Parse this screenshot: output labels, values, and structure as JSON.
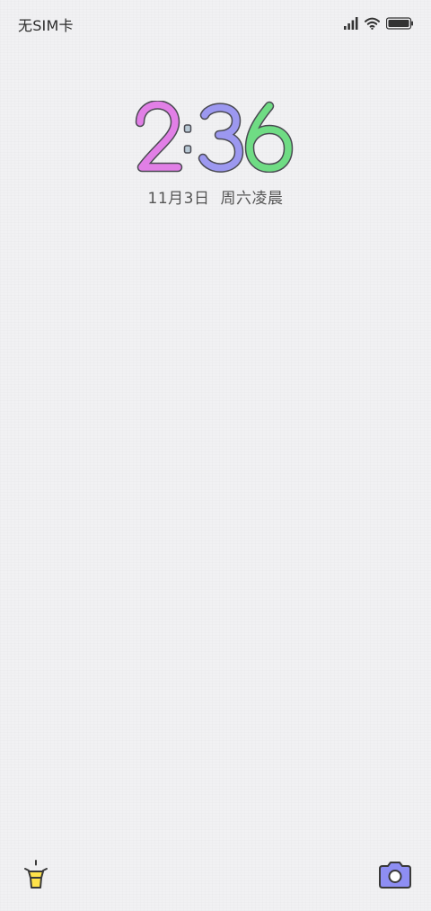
{
  "status_bar": {
    "carrier": "无SIM卡",
    "signal_icon": "signal-bars-icon",
    "wifi_icon": "wifi-icon",
    "battery_icon": "battery-icon"
  },
  "lockscreen": {
    "time": {
      "hours": "2",
      "minutes_tens": "3",
      "minutes_ones": "6",
      "colors": {
        "hours": "#e17fe6",
        "minutes_tens": "#9c98f0",
        "minutes_ones": "#6fdc84",
        "separator": "#b7c8d4",
        "outline": "#4a4a52"
      }
    },
    "date": "11月3日",
    "weekday_period": "周六凌晨"
  },
  "shortcuts": {
    "flashlight": {
      "icon": "flashlight-icon",
      "color": "#ffe24a"
    },
    "camera": {
      "icon": "camera-icon",
      "color": "#8e8ef3"
    }
  }
}
